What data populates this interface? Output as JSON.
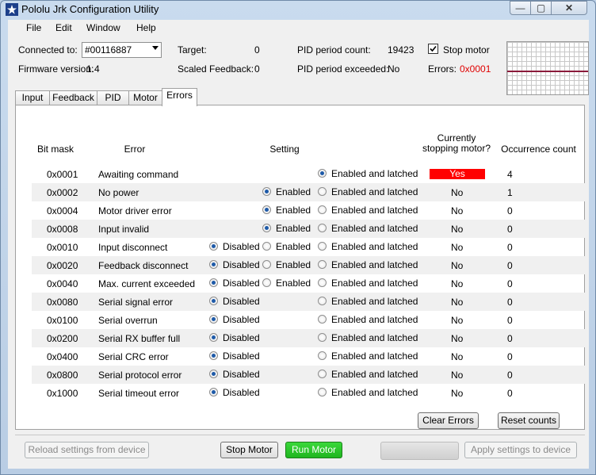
{
  "window": {
    "title": "Pololu Jrk Configuration Utility",
    "min_glyph": "—",
    "max_glyph": "▢",
    "close_glyph": "✕"
  },
  "menu": [
    "File",
    "Edit",
    "Window",
    "Help"
  ],
  "status": {
    "connected_label": "Connected to:",
    "connected_value": "#00116887",
    "firmware_label": "Firmware version:",
    "firmware_value": "1.4",
    "target_label": "Target:",
    "target_value": "0",
    "scaled_feedback_label": "Scaled Feedback:",
    "scaled_feedback_value": "0",
    "pid_count_label": "PID period count:",
    "pid_count_value": "19423",
    "pid_exceeded_label": "PID period exceeded:",
    "pid_exceeded_value": "No",
    "stop_motor_label": "Stop motor",
    "stop_motor_checked": true,
    "errors_label": "Errors:",
    "errors_value": "0x0001",
    "errors_color": "#e00000"
  },
  "tabs": [
    {
      "label": "Input",
      "active": false
    },
    {
      "label": "Feedback",
      "active": false
    },
    {
      "label": "PID",
      "active": false
    },
    {
      "label": "Motor",
      "active": false
    },
    {
      "label": "Errors",
      "active": true
    }
  ],
  "table": {
    "headers": {
      "bitmask": "Bit mask",
      "error": "Error",
      "setting": "Setting",
      "stopping_line1": "Currently",
      "stopping_line2": "stopping motor?",
      "count": "Occurrence count"
    },
    "option_labels": {
      "disabled": "Disabled",
      "enabled": "Enabled",
      "latched": "Enabled and latched"
    },
    "rows": [
      {
        "mask": "0x0001",
        "name": "Awaiting command",
        "options": [
          "latched"
        ],
        "selected": "latched",
        "stopping": "Yes",
        "count": "4"
      },
      {
        "mask": "0x0002",
        "name": "No power",
        "options": [
          "enabled",
          "latched"
        ],
        "selected": "enabled",
        "stopping": "No",
        "count": "1"
      },
      {
        "mask": "0x0004",
        "name": "Motor driver error",
        "options": [
          "enabled",
          "latched"
        ],
        "selected": "enabled",
        "stopping": "No",
        "count": "0"
      },
      {
        "mask": "0x0008",
        "name": "Input invalid",
        "options": [
          "enabled",
          "latched"
        ],
        "selected": "enabled",
        "stopping": "No",
        "count": "0"
      },
      {
        "mask": "0x0010",
        "name": "Input disconnect",
        "options": [
          "disabled",
          "enabled",
          "latched"
        ],
        "selected": "disabled",
        "stopping": "No",
        "count": "0"
      },
      {
        "mask": "0x0020",
        "name": "Feedback disconnect",
        "options": [
          "disabled",
          "enabled",
          "latched"
        ],
        "selected": "disabled",
        "stopping": "No",
        "count": "0"
      },
      {
        "mask": "0x0040",
        "name": "Max. current exceeded",
        "options": [
          "disabled",
          "enabled",
          "latched"
        ],
        "selected": "disabled",
        "stopping": "No",
        "count": "0"
      },
      {
        "mask": "0x0080",
        "name": "Serial signal error",
        "options": [
          "disabled",
          "latched"
        ],
        "selected": "disabled",
        "stopping": "No",
        "count": "0"
      },
      {
        "mask": "0x0100",
        "name": "Serial overrun",
        "options": [
          "disabled",
          "latched"
        ],
        "selected": "disabled",
        "stopping": "No",
        "count": "0"
      },
      {
        "mask": "0x0200",
        "name": "Serial RX buffer full",
        "options": [
          "disabled",
          "latched"
        ],
        "selected": "disabled",
        "stopping": "No",
        "count": "0"
      },
      {
        "mask": "0x0400",
        "name": "Serial CRC error",
        "options": [
          "disabled",
          "latched"
        ],
        "selected": "disabled",
        "stopping": "No",
        "count": "0"
      },
      {
        "mask": "0x0800",
        "name": "Serial protocol error",
        "options": [
          "disabled",
          "latched"
        ],
        "selected": "disabled",
        "stopping": "No",
        "count": "0"
      },
      {
        "mask": "0x1000",
        "name": "Serial timeout error",
        "options": [
          "disabled",
          "latched"
        ],
        "selected": "disabled",
        "stopping": "No",
        "count": "0"
      }
    ]
  },
  "buttons": {
    "clear_errors": "Clear Errors",
    "reset_counts": "Reset counts",
    "reload": "Reload settings from device",
    "stop_motor": "Stop Motor",
    "run_motor": "Run Motor",
    "apply": "Apply settings to device"
  }
}
